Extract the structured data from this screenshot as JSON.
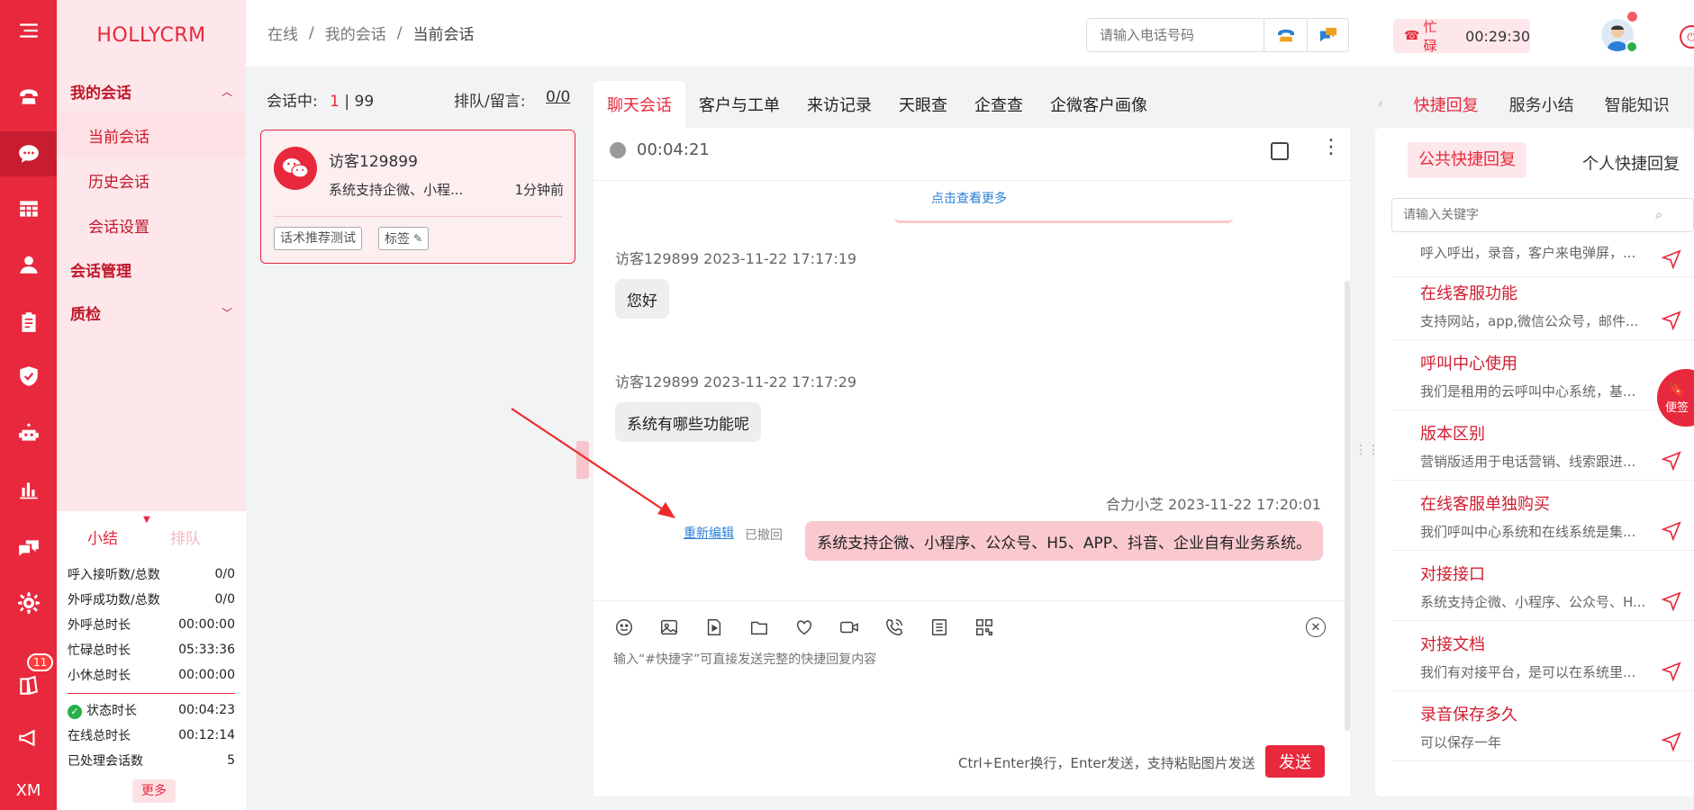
{
  "brand": "HOLLYCRM",
  "rail_badge": "11",
  "rail_footer": "XM",
  "nav": {
    "my_sessions": "我的会话",
    "current_session": "当前会话",
    "history_session": "历史会话",
    "session_settings": "会话设置",
    "session_management": "会话管理",
    "quality_check": "质检"
  },
  "stats": {
    "tab_summary": "小结",
    "tab_queue": "排队",
    "rows": [
      {
        "label": "呼入接听数/总数",
        "value": "0/0"
      },
      {
        "label": "外呼成功数/总数",
        "value": "0/0"
      },
      {
        "label": "外呼总时长",
        "value": "00:00:00"
      },
      {
        "label": "忙碌总时长",
        "value": "05:33:36"
      },
      {
        "label": "小休总时长",
        "value": "00:00:00"
      }
    ],
    "rows2": [
      {
        "label": "状态时长",
        "value": "00:04:23"
      },
      {
        "label": "在线总时长",
        "value": "00:12:14"
      },
      {
        "label": "已处理会话数",
        "value": "5"
      }
    ],
    "more": "更多"
  },
  "header": {
    "breadcrumb": [
      "在线",
      "我的会话",
      "当前会话"
    ],
    "separator": "/",
    "phone_placeholder": "请输入电话号码",
    "status": "忙碌",
    "timer": "00:29:30"
  },
  "session_list": {
    "in_session_label": "会话中:",
    "in_session_count": "1",
    "in_session_total": "| 99",
    "queue_label": "排队/留言:",
    "queue_value": "0/0",
    "visitor_name": "访客129899",
    "visitor_preview": "系统支持企微、小程...",
    "visitor_time": "1分钟前",
    "tag_test": "话术推荐测试",
    "tag_label": "标签"
  },
  "tabs": [
    "聊天会话",
    "客户与工单",
    "来访记录",
    "天眼查",
    "企查查",
    "企微客户画像"
  ],
  "chat": {
    "duration": "00:04:21",
    "view_more": "点击查看更多",
    "messages": [
      {
        "meta": "访客129899 2023-11-22 17:17:19",
        "text": "您好"
      },
      {
        "meta": "访客129899 2023-11-22 17:17:29",
        "text": "系统有哪些功能呢"
      }
    ],
    "agent_meta": "合力小芝 2023-11-22 17:20:01",
    "agent_text": "系统支持企微、小程序、公众号、H5、APP、抖音、企业自有业务系统。",
    "re_edit": "重新编辑",
    "recalled": "已撤回",
    "input_placeholder": "输入“#快捷字”可直接发送完整的快捷回复内容",
    "hint": "Ctrl+Enter换行，Enter发送，支持粘贴图片发送",
    "send": "发送"
  },
  "right": {
    "tabs": [
      "快捷回复",
      "服务小结",
      "智能知识"
    ],
    "sub_tabs": [
      "公共快捷回复",
      "个人快捷回复"
    ],
    "search_placeholder": "请输入关键字",
    "first_desc": "呼入呼出，录音，客户来电弹屏，...",
    "items": [
      {
        "title": "在线客服功能",
        "desc": "支持网站，app,微信公众号，邮件..."
      },
      {
        "title": "呼叫中心使用",
        "desc": "我们是租用的云呼叫中心系统，基..."
      },
      {
        "title": "版本区别",
        "desc": "营销版适用于电话营销、线索跟进..."
      },
      {
        "title": "在线客服单独购买",
        "desc": "我们呼叫中心系统和在线系统是集..."
      },
      {
        "title": "对接接口",
        "desc": "系统支持企微、小程序、公众号、H..."
      },
      {
        "title": "对接文档",
        "desc": "我们有对接平台，是可以在系统里..."
      },
      {
        "title": "录音保存多久",
        "desc": "可以保存一年"
      }
    ],
    "sticky": "便签"
  },
  "colors": {
    "primary": "#e8283c",
    "nav_active_bg": "#fde1e4",
    "bubble_agent": "#f9c9cf"
  }
}
